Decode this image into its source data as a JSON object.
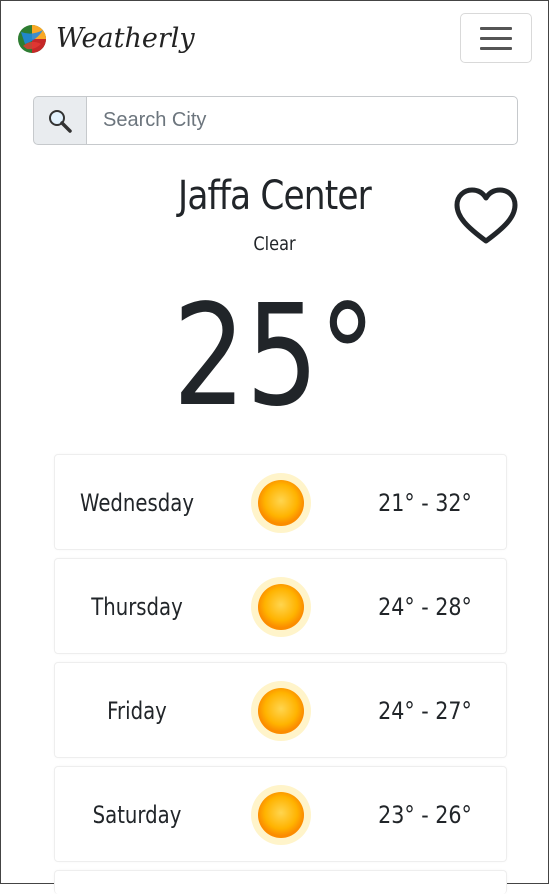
{
  "brand": {
    "name": "Weatherly"
  },
  "search": {
    "placeholder": "Search City"
  },
  "location": {
    "city": "Jaffa Center",
    "condition": "Clear",
    "temperature": "25°"
  },
  "forecast": [
    {
      "day": "Wednesday",
      "icon": "sun-icon",
      "range": "21° - 32°"
    },
    {
      "day": "Thursday",
      "icon": "sun-icon",
      "range": "24° - 28°"
    },
    {
      "day": "Friday",
      "icon": "sun-icon",
      "range": "24° - 27°"
    },
    {
      "day": "Saturday",
      "icon": "sun-icon",
      "range": "23° - 26°"
    }
  ],
  "colors": {
    "sun_core": "#ffb300",
    "sun_glow": "#ffe08a",
    "text": "#212529"
  }
}
